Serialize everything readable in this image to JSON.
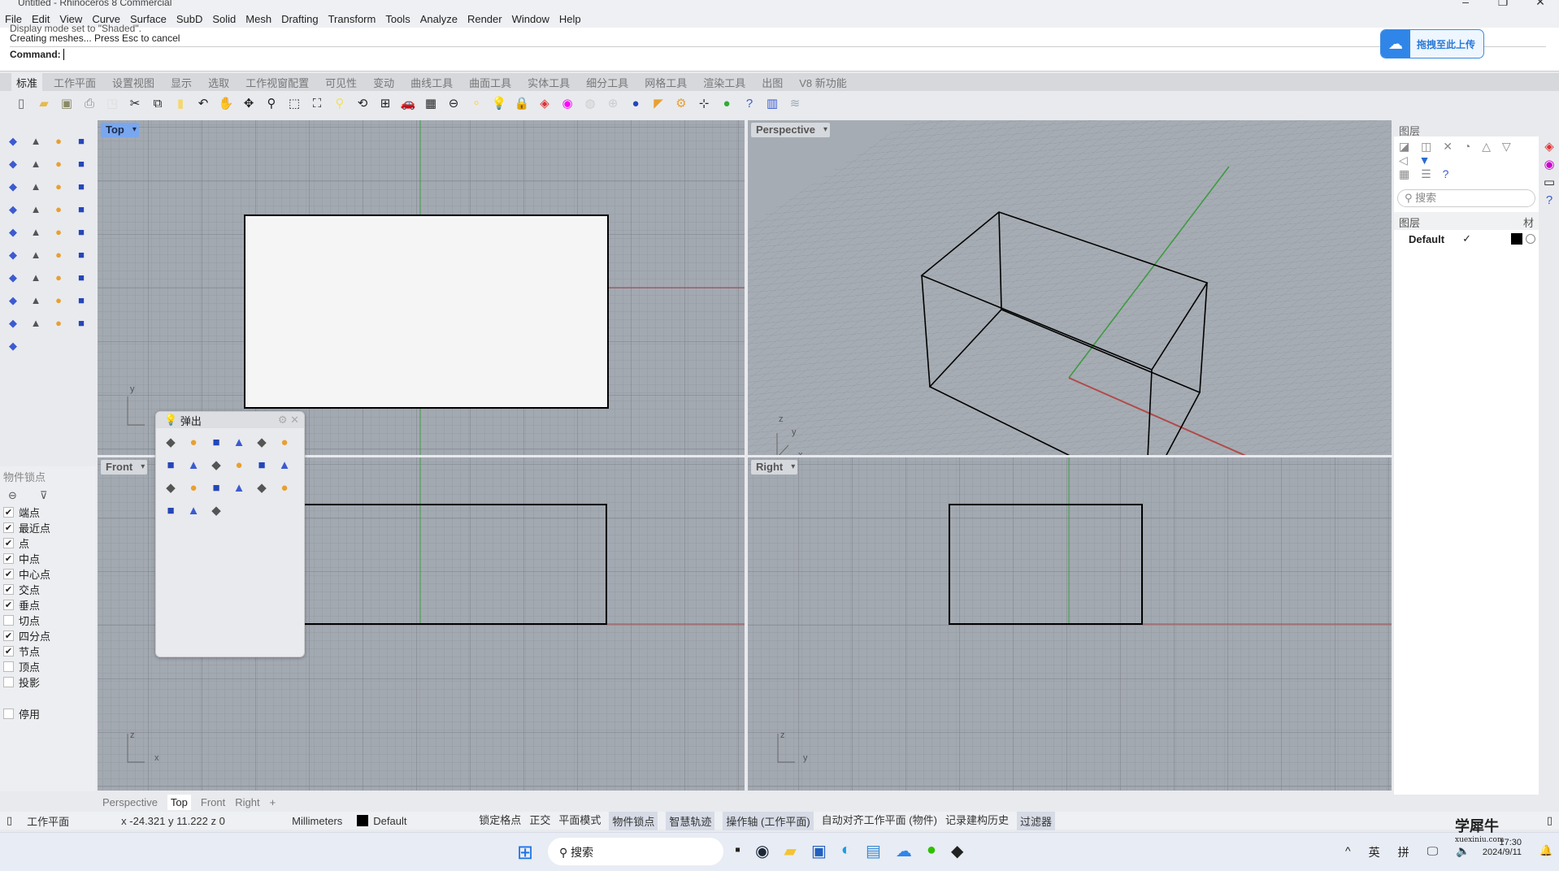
{
  "window": {
    "title": "Untitled - Rhinoceros 8 Commercial",
    "controls": [
      "–",
      "❐",
      "✕"
    ]
  },
  "menu": [
    "File",
    "Edit",
    "View",
    "Curve",
    "Surface",
    "SubD",
    "Solid",
    "Mesh",
    "Drafting",
    "Transform",
    "Tools",
    "Analyze",
    "Render",
    "Window",
    "Help"
  ],
  "command": {
    "history": [
      "Display mode set to \"Shaded\".",
      "Creating meshes... Press Esc to cancel"
    ],
    "prompt": "Command:",
    "value": ""
  },
  "upload": {
    "label": "拖拽至此上传"
  },
  "tabs": [
    "标准",
    "工作平面",
    "设置视图",
    "显示",
    "选取",
    "工作视窗配置",
    "可见性",
    "变动",
    "曲线工具",
    "曲面工具",
    "实体工具",
    "细分工具",
    "网格工具",
    "渲染工具",
    "出图",
    "V8 新功能"
  ],
  "active_tab": "标准",
  "toolbar_icons": [
    [
      "new-file",
      "▯",
      "#fff"
    ],
    [
      "open-folder",
      "▰",
      "#e6b94a"
    ],
    [
      "save",
      "▣",
      "#8a8a66"
    ],
    [
      "print",
      "⎙",
      "#888"
    ],
    [
      "import",
      "◳",
      "#ddd"
    ],
    [
      "cut",
      "✂",
      "none"
    ],
    [
      "copy",
      "⧉",
      "none"
    ],
    [
      "paste",
      "▮",
      "#f5d76e"
    ],
    [
      "undo",
      "↶",
      "none"
    ],
    [
      "pan-hand",
      "✋",
      "none"
    ],
    [
      "rotate-view",
      "✥",
      "none"
    ],
    [
      "zoom",
      "⚲",
      "none"
    ],
    [
      "zoom-window",
      "⬚",
      "none"
    ],
    [
      "zoom-extents",
      "⛶",
      "none"
    ],
    [
      "zoom-selected",
      "⚲",
      "#f0e060"
    ],
    [
      "rotate-camera",
      "⟲",
      "none"
    ],
    [
      "four-viewports",
      "⊞",
      "none"
    ],
    [
      "car-icon",
      "🚗",
      "none"
    ],
    [
      "grid-icon",
      "▦",
      "none"
    ],
    [
      "cplane",
      "⊖",
      "none"
    ],
    [
      "point-light",
      "⚬",
      "#f5d76e"
    ],
    [
      "light-bulb",
      "💡",
      "none"
    ],
    [
      "lock",
      "🔒",
      "none"
    ],
    [
      "layer",
      "◈",
      "#d33"
    ],
    [
      "color-wheel",
      "◉",
      "#f0f"
    ],
    [
      "render-sphere",
      "◍",
      "#ccc"
    ],
    [
      "grid-sphere",
      "⊕",
      "#ccc"
    ],
    [
      "blue-sphere",
      "●",
      "#2446b8"
    ],
    [
      "pointer-tool",
      "◤",
      "#e8a030"
    ],
    [
      "puzzle-gear",
      "⚙",
      "#e8a030"
    ],
    [
      "snap-grid",
      "⊹",
      "none"
    ],
    [
      "green-sphere",
      "●",
      "#3a3"
    ],
    [
      "help",
      "?",
      "#3b5bd0"
    ],
    [
      "bookmark",
      "▥",
      "#3b5bd0"
    ],
    [
      "layer-stack",
      "≋",
      "#9ab"
    ]
  ],
  "left_tools": [
    "select-arrow",
    "point",
    "polyline",
    "curve",
    "circle",
    "ellipse",
    "arc",
    "rectangle",
    "polygon",
    "fillet-curve",
    "surface-points",
    "surface-edge",
    "box",
    "boolean-union",
    "cylinder-surface",
    "patch",
    "explode",
    "split",
    "trim",
    "extend",
    "boolean",
    "points",
    "curve-arc",
    "offset",
    "text",
    "scale",
    "array",
    "transform",
    "solid-edit",
    "extrude",
    "grid-array",
    "gumball",
    "surface-fold",
    "split-surface",
    "check",
    "solid-shapes",
    "projection"
  ],
  "viewports": {
    "top": "Top",
    "perspective": "Perspective",
    "front": "Front",
    "right": "Right"
  },
  "axes": {
    "top": [
      "x",
      "y"
    ],
    "perspective": [
      "z",
      "y",
      "x"
    ],
    "front": [
      "z",
      "x"
    ],
    "right": [
      "z",
      "y"
    ]
  },
  "osnap": {
    "title": "物件锁点",
    "items": [
      {
        "label": "端点",
        "checked": true
      },
      {
        "label": "最近点",
        "checked": true
      },
      {
        "label": "点",
        "checked": true
      },
      {
        "label": "中点",
        "checked": true
      },
      {
        "label": "中心点",
        "checked": true
      },
      {
        "label": "交点",
        "checked": true
      },
      {
        "label": "垂点",
        "checked": true
      },
      {
        "label": "切点",
        "checked": false
      },
      {
        "label": "四分点",
        "checked": true
      },
      {
        "label": "节点",
        "checked": true
      },
      {
        "label": "顶点",
        "checked": false
      },
      {
        "label": "投影",
        "checked": false
      }
    ],
    "disable": {
      "label": "停用",
      "checked": false
    }
  },
  "popup": {
    "title": "弹出",
    "icons": [
      "light-bulb",
      "lock",
      "save",
      "zoom-window",
      "grid-sphere",
      "blue-sphere",
      "color-wheel",
      "puzzle-gear",
      "explode",
      "spot-light",
      "bend-surface",
      "curve-points",
      "box",
      "cylinder",
      "twist",
      "blend-2",
      "blend-1",
      "loft",
      "plane-surface",
      "layer-stack",
      "red-green-box"
    ]
  },
  "layers_panel": {
    "title": "图层",
    "search_placeholder": "搜索",
    "col_layer": "图层",
    "col_material": "材",
    "rows": [
      {
        "name": "Default",
        "current": "✓",
        "color": "#000000"
      }
    ]
  },
  "viewport_tabs": [
    "Perspective",
    "Top",
    "Front",
    "Right"
  ],
  "active_viewport_tab": "Top",
  "status": {
    "cplane": "工作平面",
    "coords": "x -24.321  y 11.222  z 0",
    "units": "Millimeters",
    "layer": "Default",
    "toggles": [
      {
        "label": "锁定格点",
        "on": false
      },
      {
        "label": "正交",
        "on": false
      },
      {
        "label": "平面模式",
        "on": false
      },
      {
        "label": "物件锁点",
        "on": true
      },
      {
        "label": "智慧轨迹",
        "on": true
      },
      {
        "label": "操作轴 (工作平面)",
        "on": true
      },
      {
        "label": "自动对齐工作平面 (物件)",
        "on": false
      },
      {
        "label": "记录建构历史",
        "on": false
      },
      {
        "label": "过滤器",
        "on": true
      }
    ]
  },
  "taskbar": {
    "search": "搜索",
    "tray": [
      "^",
      "英",
      "拼"
    ],
    "time": "17:30",
    "date": "2024/9/11",
    "watermark": "学犀牛",
    "watermark_url": "xuexiniu.com"
  }
}
